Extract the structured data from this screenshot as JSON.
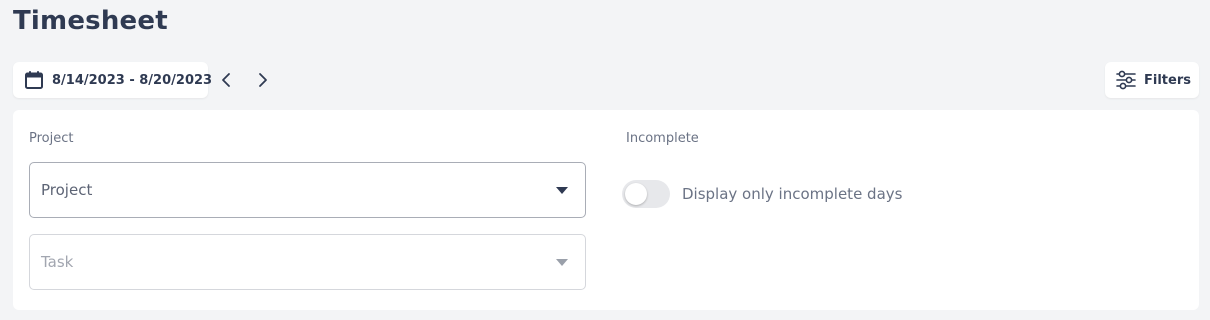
{
  "page": {
    "title": "Timesheet"
  },
  "date_range": {
    "label": "8/14/2023 - 8/20/2023",
    "icon": "calendar-icon",
    "prev_icon": "chevron-left-icon",
    "next_icon": "chevron-right-icon"
  },
  "filters_button": {
    "label": "Filters",
    "icon": "sliders-icon"
  },
  "filters_panel": {
    "project_section_label": "Project",
    "project_select": {
      "placeholder": "Project",
      "icon": "caret-down-icon"
    },
    "task_select": {
      "placeholder": "Task",
      "icon": "caret-down-icon",
      "disabled": true
    },
    "incomplete_section_label": "Incomplete",
    "incomplete_toggle": {
      "label": "Display only incomplete days",
      "checked": false
    }
  },
  "colors": {
    "background": "#f3f4f6",
    "text_dark": "#2f3a52",
    "text_muted": "#6b7385",
    "toggle_off": "#e7e8eb"
  }
}
